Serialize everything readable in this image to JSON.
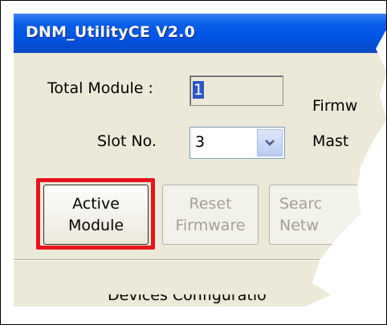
{
  "window": {
    "title": "DNM_UtilityCE V2.0"
  },
  "form": {
    "total_module_label": "Total Module :",
    "total_module_value": "1",
    "firmware_label_partial": "Firmw",
    "slot_label": "Slot No.",
    "slot_value": "3",
    "master_label_partial": "Mast"
  },
  "buttons": {
    "active_line1": "Active",
    "active_line2": "Module",
    "reset_line1": "Reset",
    "reset_line2": "Firmware",
    "search_line1": "Searc",
    "search_line2": "Netw"
  },
  "section": {
    "label_partial": "Devices Configuratio"
  },
  "colors": {
    "highlight": "#e8141b",
    "titlebar": "#0054e3"
  },
  "icons": {
    "combo_arrow": "chevron-down-icon"
  }
}
